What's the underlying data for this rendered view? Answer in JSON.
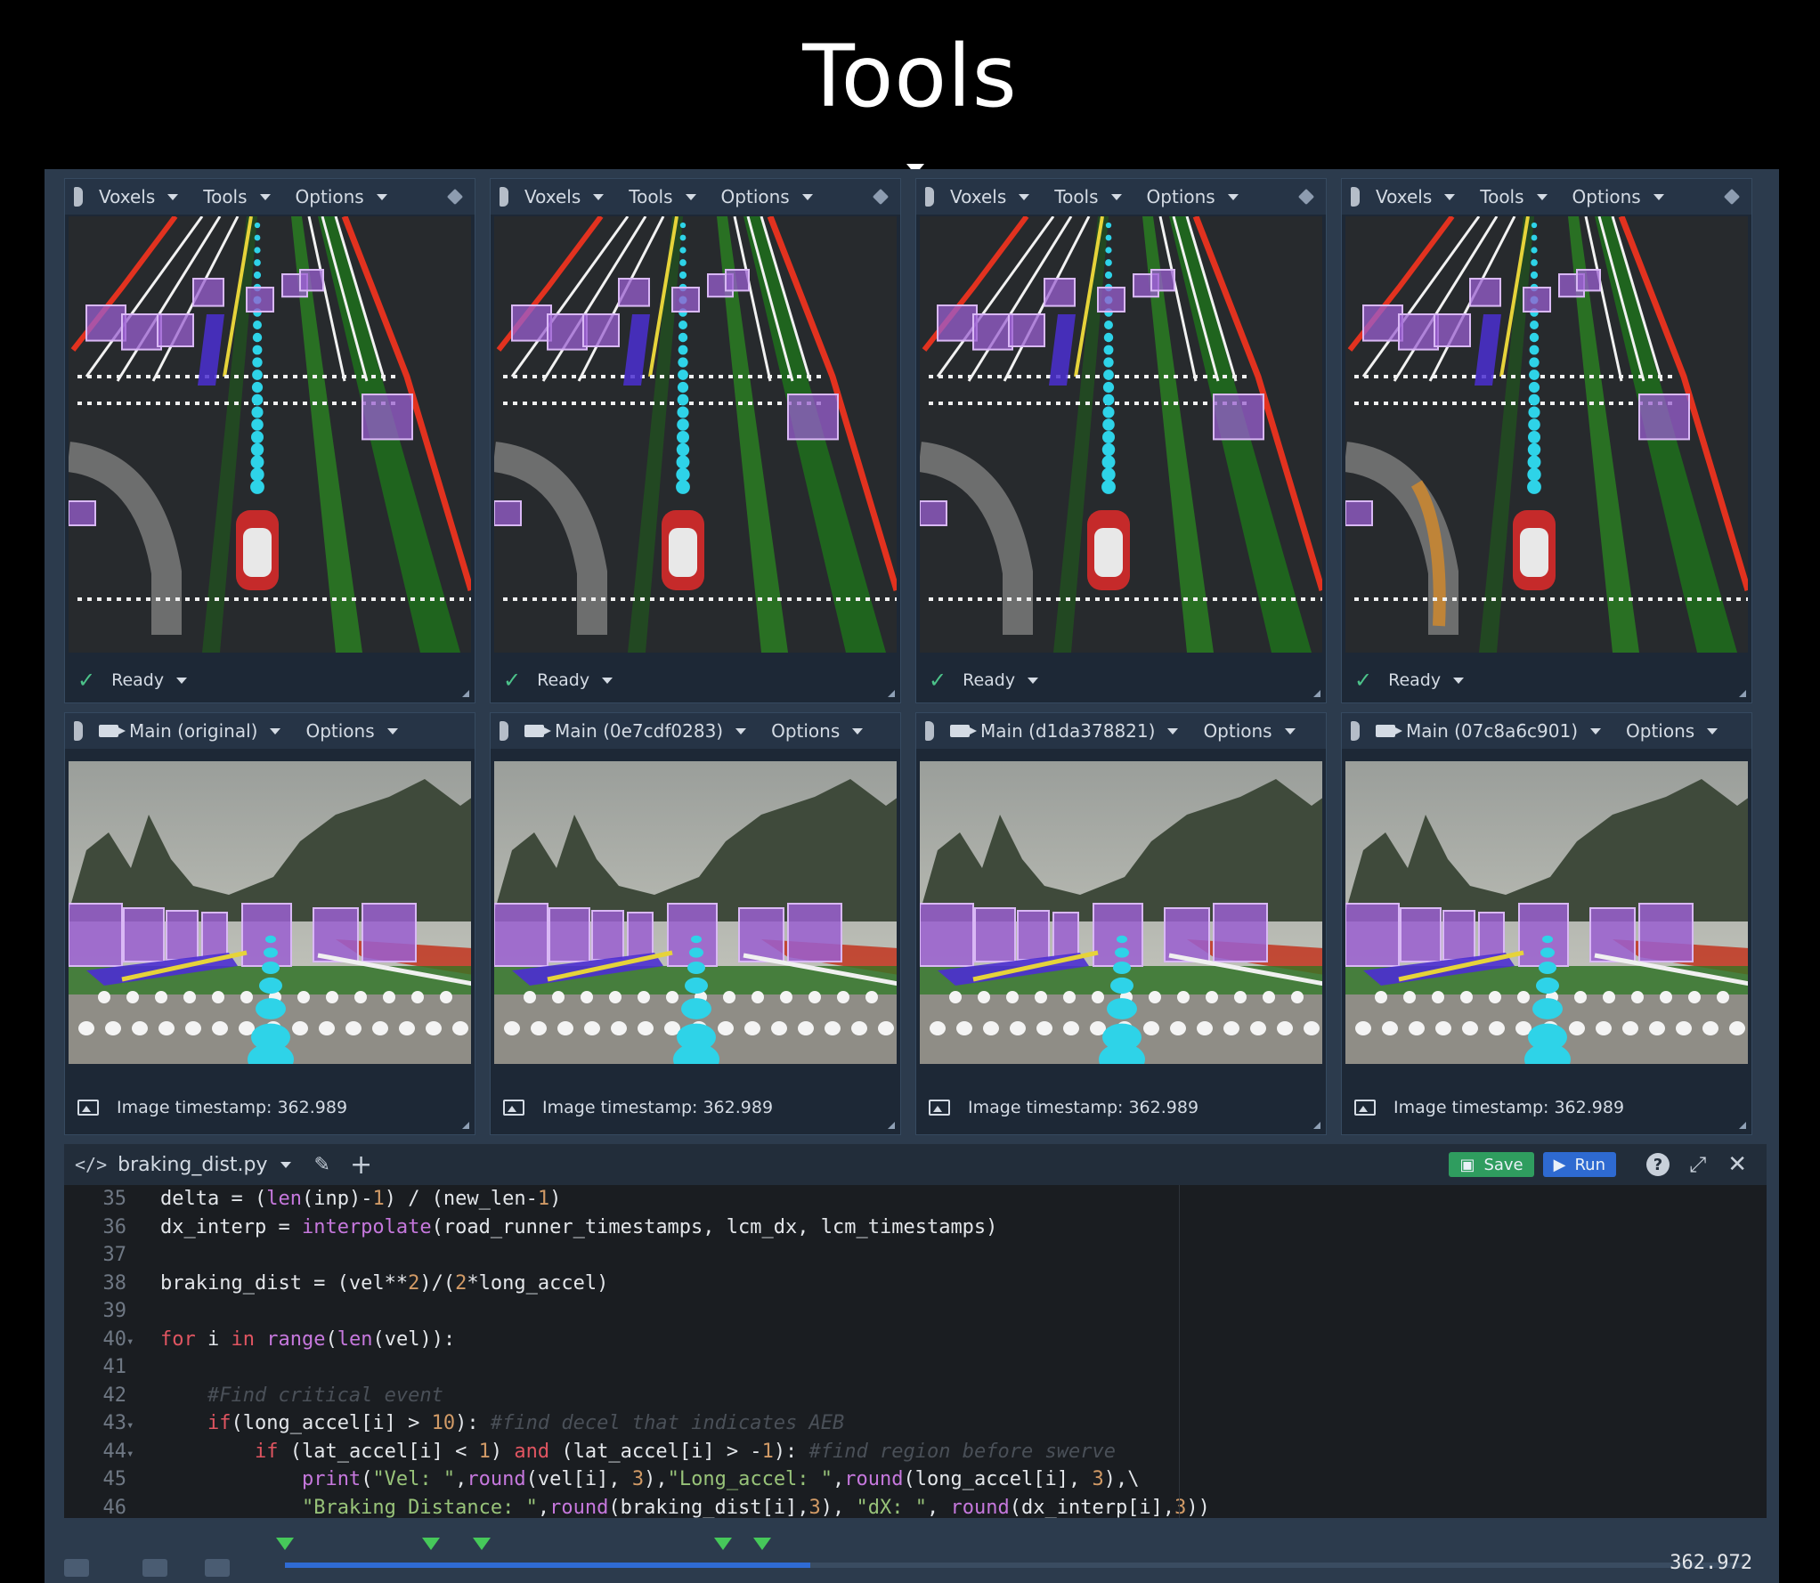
{
  "slide": {
    "title": "Tools"
  },
  "voxel_panels": [
    {
      "menus": [
        "Voxels",
        "Tools",
        "Options"
      ],
      "status": "Ready"
    },
    {
      "menus": [
        "Voxels",
        "Tools",
        "Options"
      ],
      "status": "Ready"
    },
    {
      "menus": [
        "Voxels",
        "Tools",
        "Options"
      ],
      "status": "Ready"
    },
    {
      "menus": [
        "Voxels",
        "Tools",
        "Options"
      ],
      "status": "Ready"
    }
  ],
  "camera_panels": [
    {
      "camera": "Main (original)",
      "options": "Options",
      "timestamp": "Image timestamp: 362.989"
    },
    {
      "camera": "Main (0e7cdf0283)",
      "options": "Options",
      "timestamp": "Image timestamp: 362.989"
    },
    {
      "camera": "Main (d1da378821)",
      "options": "Options",
      "timestamp": "Image timestamp: 362.989"
    },
    {
      "camera": "Main (07c8a6c901)",
      "options": "Options",
      "timestamp": "Image timestamp: 362.989"
    }
  ],
  "editor": {
    "filename": "braking_dist.py",
    "save_label": "Save",
    "run_label": "Run",
    "help_label": "?",
    "lines": [
      {
        "n": "35",
        "fold": "",
        "code": "delta = (len(inp)-1) / (new_len-1)"
      },
      {
        "n": "36",
        "fold": "",
        "code": "dx_interp = interpolate(road_runner_timestamps, lcm_dx, lcm_timestamps)"
      },
      {
        "n": "37",
        "fold": "",
        "code": ""
      },
      {
        "n": "38",
        "fold": "",
        "code": "braking_dist = (vel**2)/(2*long_accel)"
      },
      {
        "n": "39",
        "fold": "",
        "code": ""
      },
      {
        "n": "40",
        "fold": "▾",
        "code": "for i in range(len(vel)):"
      },
      {
        "n": "41",
        "fold": "",
        "code": ""
      },
      {
        "n": "42",
        "fold": "",
        "code": "    #Find critical event"
      },
      {
        "n": "43",
        "fold": "▾",
        "code": "    if(long_accel[i] > 10): #find decel that indicates AEB"
      },
      {
        "n": "44",
        "fold": "▾",
        "code": "        if (lat_accel[i] < 1) and (lat_accel[i] > -1): #find region before swerve"
      },
      {
        "n": "45",
        "fold": "",
        "code": "            print(\"Vel: \",round(vel[i], 3),\"Long_accel: \",round(long_accel[i], 3),\\"
      },
      {
        "n": "46",
        "fold": "",
        "code": "            \"Braking Distance: \",round(braking_dist[i],3), \"dX: \", round(dx_interp[i],3))"
      }
    ]
  },
  "timeline": {
    "current_time": "362.972",
    "progress_fraction": 0.36,
    "event_markers": [
      0.0,
      0.1,
      0.135,
      0.3,
      0.327
    ]
  },
  "colors": {
    "accent_green": "#46c85a",
    "accent_blue": "#2f6bd4",
    "voxel_purple": "#9a5fd0",
    "trajectory_cyan": "#2ed3e8"
  }
}
